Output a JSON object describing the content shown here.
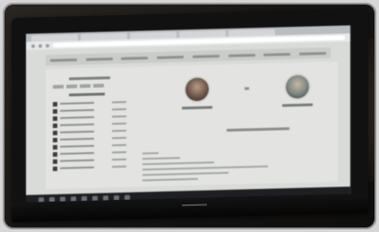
{
  "scene": {
    "kind": "photo",
    "subject": "laptop-screen",
    "colors": {
      "frame": "#1a1816",
      "screen": "#d9dbd8",
      "taskbar": "#1d1f22"
    }
  },
  "screen": {
    "browser_tab_count": 5,
    "nav_item_count": 8,
    "ranking_row_count": 10,
    "text_line_count": 6,
    "taskbar_icon_count": 9,
    "players": [
      "player-left",
      "player-right"
    ]
  }
}
